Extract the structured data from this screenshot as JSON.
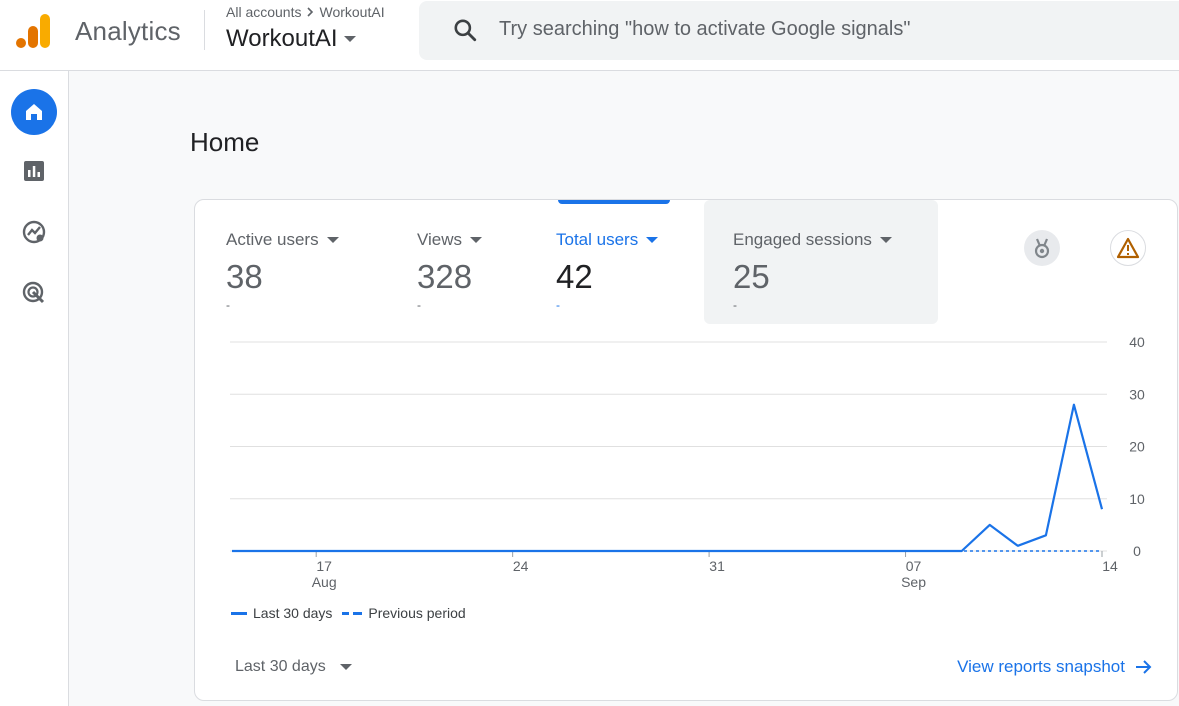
{
  "header": {
    "app_name": "Analytics",
    "breadcrumb_root": "All accounts",
    "breadcrumb_current": "WorkoutAI",
    "property_name": "WorkoutAI",
    "search_placeholder": "Try searching \"how to activate Google signals\""
  },
  "sidenav": {
    "items": [
      {
        "icon": "home-icon",
        "active": true
      },
      {
        "icon": "reports-icon",
        "active": false
      },
      {
        "icon": "explore-icon",
        "active": false
      },
      {
        "icon": "advertising-icon",
        "active": false
      }
    ]
  },
  "page": {
    "title": "Home"
  },
  "metrics": [
    {
      "label": "Active users",
      "value": "38",
      "delta": "-",
      "selected": false
    },
    {
      "label": "Views",
      "value": "328",
      "delta": "-",
      "selected": false
    },
    {
      "label": "Total users",
      "value": "42",
      "delta": "-",
      "selected": true
    },
    {
      "label": "Engaged sessions",
      "value": "25",
      "delta": "-",
      "selected": false
    }
  ],
  "icons": {
    "insights": "medal-icon",
    "warning": "warning-icon"
  },
  "colors": {
    "accent": "#1a73e8",
    "warning": "#b06000"
  },
  "chart_data": {
    "type": "line",
    "y_ticks": [
      "0",
      "10",
      "20",
      "30",
      "40"
    ],
    "ylim": [
      0,
      40
    ],
    "x_ticks": [
      {
        "day": 3,
        "label": "17",
        "sub": "Aug"
      },
      {
        "day": 10,
        "label": "24",
        "sub": ""
      },
      {
        "day": 17,
        "label": "31",
        "sub": ""
      },
      {
        "day": 24,
        "label": "07",
        "sub": "Sep"
      },
      {
        "day": 31,
        "label": "14",
        "sub": ""
      }
    ],
    "series": [
      {
        "name": "Last 30 days",
        "style": "solid",
        "values": [
          0,
          0,
          0,
          0,
          0,
          0,
          0,
          0,
          0,
          0,
          0,
          0,
          0,
          0,
          0,
          0,
          0,
          0,
          0,
          0,
          0,
          0,
          0,
          0,
          0,
          0,
          0,
          5,
          1,
          3,
          28,
          8
        ]
      },
      {
        "name": "Previous period",
        "style": "dashed",
        "values": [
          0,
          0,
          0,
          0,
          0,
          0,
          0,
          0,
          0,
          0,
          0,
          0,
          0,
          0,
          0,
          0,
          0,
          0,
          0,
          0,
          0,
          0,
          0,
          0,
          0,
          0,
          0,
          0,
          0,
          0,
          0,
          0
        ]
      }
    ]
  },
  "footer": {
    "date_range": "Last 30 days",
    "snapshot_link": "View reports snapshot"
  }
}
